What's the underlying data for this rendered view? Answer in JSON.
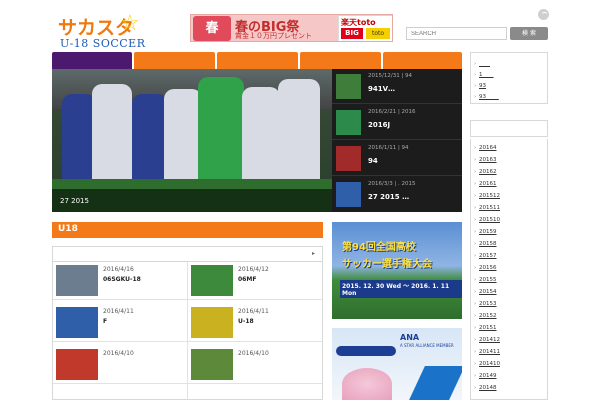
{
  "header": {
    "logo_main": "サカスタ",
    "logo_star": "☆",
    "logo_sub": "U-18 SOCCER",
    "search_placeholder": "SEARCH",
    "search_button": "検 索"
  },
  "banner": {
    "big_title": "春のBIG祭",
    "sub_text": "賞金１０万円プレゼント",
    "flower_text": "春",
    "toto_brand": "楽天toto",
    "toto_big": "BIG",
    "toto_mini": "toto"
  },
  "nav": {
    "colors": [
      "#4b1a6e",
      "#f47a19",
      "#f47a19",
      "#f47a19",
      "#f47a19"
    ]
  },
  "slider": {
    "caption": "27 2015",
    "thumbs": [
      {
        "meta": "2015/12/31  |  94",
        "title": "941V…",
        "color": "#3f7d3a"
      },
      {
        "meta": "2016/2/21  |  2016",
        "title": "2016J",
        "color": "#2c8a4a"
      },
      {
        "meta": "2016/1/11  |  94",
        "title": "94",
        "color": "#a12b2b"
      },
      {
        "meta": "2016/3/3  |  . 2015",
        "title": "27 2015 …",
        "color": "#2f5fa8"
      }
    ]
  },
  "section": {
    "title": "U18",
    "posts": [
      {
        "date": "2016/4/16",
        "title": "06SGKU-18",
        "color": "#6b7d8f"
      },
      {
        "date": "2016/4/12",
        "title": "06MF",
        "color": "#3d8a3d"
      },
      {
        "date": "2016/4/11",
        "title": "F",
        "color": "#2f5fa8"
      },
      {
        "date": "2016/4/11",
        "title": "U-18",
        "color": "#c9b11f"
      },
      {
        "date": "2016/4/10",
        "title": "",
        "color": "#c0392b"
      },
      {
        "date": "2016/4/10",
        "title": "",
        "color": "#5d8a3a"
      }
    ]
  },
  "ads": {
    "ad1_line1": "第94回全国高校",
    "ad1_line2": "サッカー選手権大会",
    "ad1_line3": "2015. 12. 30 Wed ～ 2016. 1. 11 Mon",
    "ad2_brand": "ANA",
    "ad2_sub": "A STAR ALLIANCE MEMBER"
  },
  "sidebar": {
    "top_links": [
      "____",
      "1____",
      "93",
      "93 ____"
    ],
    "archive": [
      "20164",
      "20163",
      "20162",
      "20161",
      "201512",
      "201511",
      "201510",
      "20159",
      "20158",
      "20157",
      "20156",
      "20155",
      "20154",
      "20153",
      "20152",
      "20151",
      "201412",
      "201411",
      "201410",
      "20149",
      "20148"
    ]
  }
}
